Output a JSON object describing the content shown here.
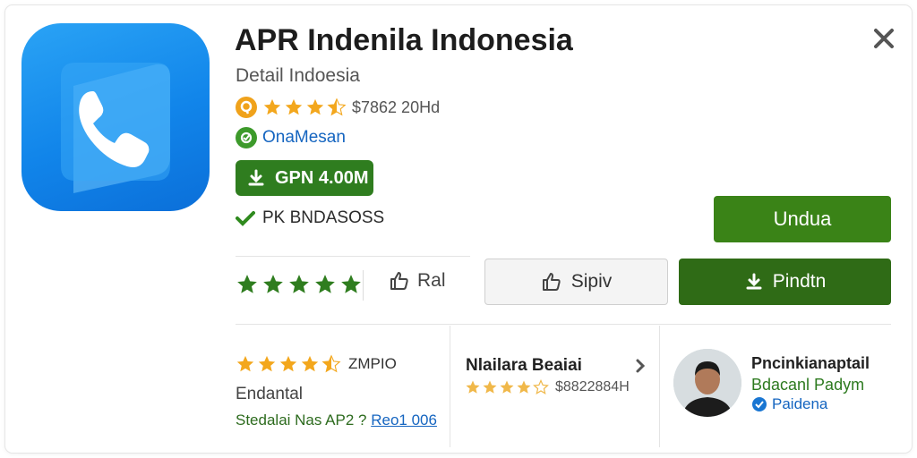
{
  "app": {
    "title": "APR Indenila Indonesia",
    "subtitle": "Detail Indoesia",
    "icon": "phone-app-icon",
    "brand_color": "#1185ea"
  },
  "header": {
    "close_icon": "close-icon"
  },
  "rating": {
    "badge_icon": "award-icon",
    "stars": 3.5,
    "text": "$7862 20Hd"
  },
  "developer": {
    "icon": "developer-icon",
    "name": "OnaMesan"
  },
  "size_badge": {
    "icon": "download-icon",
    "label": "GPN 4.00M"
  },
  "verified": {
    "icon": "check-icon",
    "label": "PK BNDASOSS"
  },
  "buttons": {
    "primary": "Undua",
    "like": "Ral",
    "share": "Sipiv",
    "install": "Pindtn",
    "accent": "#3a8317",
    "install_color": "#2f6b16"
  },
  "user_rating_stars": 5,
  "bottom": {
    "col1": {
      "stars": 4.5,
      "count": "ZMPIO",
      "label": "Endantal",
      "footer_prefix": "Stedalai Nas AP2 ?",
      "footer_link": "Reo1 006"
    },
    "col2": {
      "title": "Nlailara Beaiai",
      "stars": 4,
      "count": "$8822884H"
    },
    "col3": {
      "name": "Pncinkianaptail",
      "subtitle": "Bdacanl Padym",
      "badge": "Paidena"
    }
  }
}
